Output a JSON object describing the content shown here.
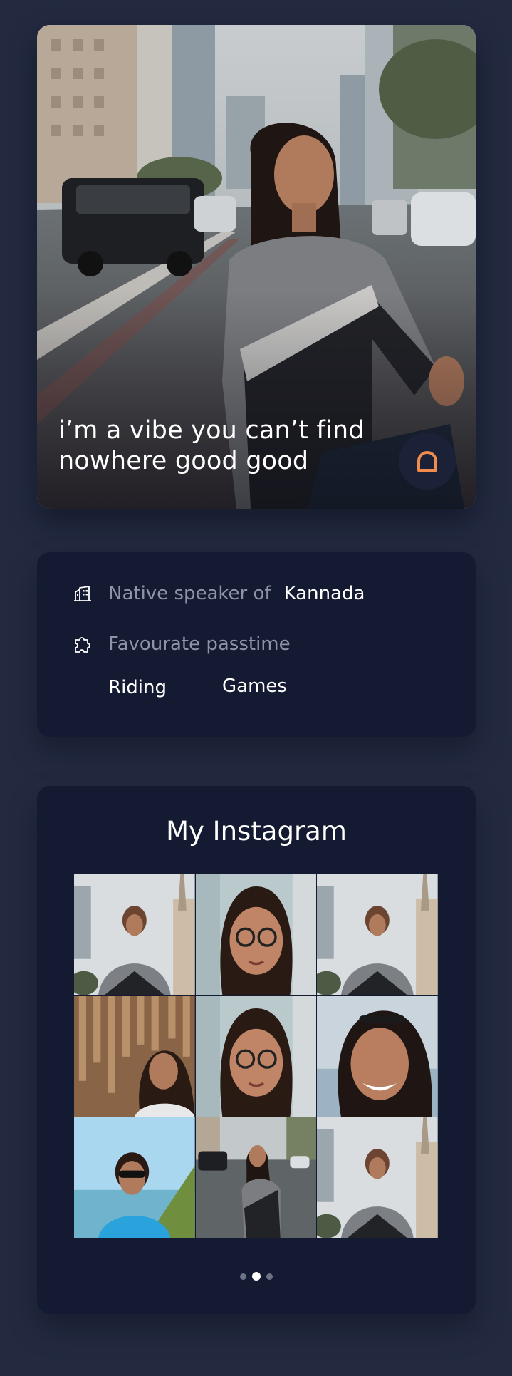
{
  "profile": {
    "bio": "i’m a vibe you can’t find nowhere good good",
    "like_icon": "heart-outline-icon",
    "accent_color": "#f28c4d"
  },
  "info": {
    "language_label": "Native speaker of",
    "language_value": "Kannada",
    "language_icon": "buildings-icon",
    "passtime_label": "Favourate passtime",
    "passtime_icon": "puzzle-icon",
    "passtimes": [
      "Riding",
      "Games"
    ]
  },
  "instagram": {
    "title": "My Instagram",
    "photo_count": 9,
    "page_count": 3,
    "active_page": 1
  },
  "colors": {
    "background": "#232a40",
    "card": "#141a31",
    "muted_text": "#8d93a8"
  }
}
